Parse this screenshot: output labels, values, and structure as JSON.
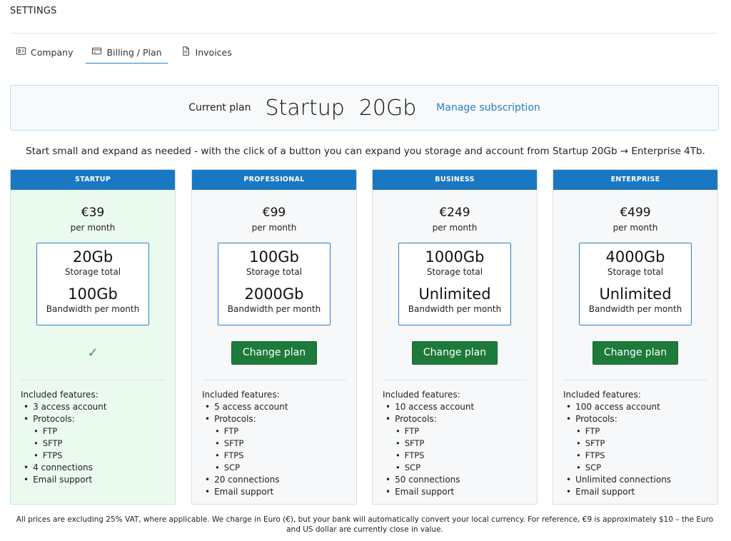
{
  "header": {
    "title": "SETTINGS"
  },
  "tabs": [
    {
      "label": "Company",
      "icon": "id-card-icon",
      "active": false
    },
    {
      "label": "Billing / Plan",
      "icon": "credit-card-icon",
      "active": true
    },
    {
      "label": "Invoices",
      "icon": "document-icon",
      "active": false
    }
  ],
  "current_plan": {
    "label": "Current plan",
    "name": "Startup",
    "size": "20Gb",
    "manage_link": "Manage subscription"
  },
  "intro": "Start small and expand as needed - with the click of a button you can expand you storage and account from Startup 20Gb → Enterprise 4Tb.",
  "plans": [
    {
      "name": "STARTUP",
      "price": "€39",
      "per": "per month",
      "storage": "20Gb",
      "storage_label": "Storage total",
      "bandwidth": "100Gb",
      "bandwidth_label": "Bandwidth per month",
      "current": true,
      "check": "✓",
      "button": "",
      "features_title": "Included features:",
      "access": "3 access account",
      "protocols_label": "Protocols:",
      "protocols": [
        "FTP",
        "SFTP",
        "FTPS"
      ],
      "connections": "4 connections",
      "support": "Email support"
    },
    {
      "name": "PROFESSIONAL",
      "price": "€99",
      "per": "per month",
      "storage": "100Gb",
      "storage_label": "Storage total",
      "bandwidth": "2000Gb",
      "bandwidth_label": "Bandwidth per month",
      "current": false,
      "check": "",
      "button": "Change plan",
      "features_title": "Included features:",
      "access": "5 access account",
      "protocols_label": "Protocols:",
      "protocols": [
        "FTP",
        "SFTP",
        "FTPS",
        "SCP"
      ],
      "connections": "20 connections",
      "support": "Email support"
    },
    {
      "name": "BUSINESS",
      "price": "€249",
      "per": "per month",
      "storage": "1000Gb",
      "storage_label": "Storage total",
      "bandwidth": "Unlimited",
      "bandwidth_label": "Bandwidth per month",
      "current": false,
      "check": "",
      "button": "Change plan",
      "features_title": "Included features:",
      "access": "10 access account",
      "protocols_label": "Protocols:",
      "protocols": [
        "FTP",
        "SFTP",
        "FTPS",
        "SCP"
      ],
      "connections": "50 connections",
      "support": "Email support"
    },
    {
      "name": "ENTERPRISE",
      "price": "€499",
      "per": "per month",
      "storage": "4000Gb",
      "storage_label": "Storage total",
      "bandwidth": "Unlimited",
      "bandwidth_label": "Bandwidth per month",
      "current": false,
      "check": "",
      "button": "Change plan",
      "features_title": "Included features:",
      "access": "100 access account",
      "protocols_label": "Protocols:",
      "protocols": [
        "FTP",
        "SFTP",
        "FTPS",
        "SCP"
      ],
      "connections": "Unlimited connections",
      "support": "Email support"
    }
  ],
  "footer": "All prices are excluding 25% VAT, where applicable. We charge in Euro (€), but your bank will automatically convert your local currency. For reference, €9 is approximately $10 – the Euro and US dollar are currently close in value.",
  "colors": {
    "accent": "#1a78c2",
    "button": "#1e7a3b",
    "current_bg": "#ebfaef"
  }
}
